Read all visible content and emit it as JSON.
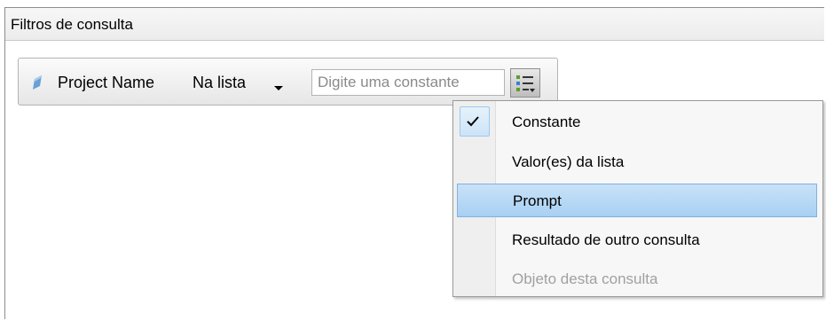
{
  "panel": {
    "title": "Filtros de consulta"
  },
  "filter": {
    "object_name": "Project Name",
    "operator": "Na lista",
    "constant_placeholder": "Digite uma constante",
    "icons": {
      "object": "dimension-object-icon",
      "operator_dropdown": "chevron-down-icon",
      "operand_type": "list-menu-icon"
    }
  },
  "menu": {
    "items": [
      {
        "label": "Constante",
        "checked": true,
        "state": "normal"
      },
      {
        "label": "Valor(es) da lista",
        "checked": false,
        "state": "normal"
      },
      {
        "label": "Prompt",
        "checked": false,
        "state": "highlighted"
      },
      {
        "label": "Resultado de outro consulta",
        "checked": false,
        "state": "normal"
      },
      {
        "label": "Objeto desta consulta",
        "checked": false,
        "state": "disabled"
      }
    ]
  },
  "colors": {
    "highlight": "#a8d0f3",
    "object_icon": "#6aa0d8"
  }
}
